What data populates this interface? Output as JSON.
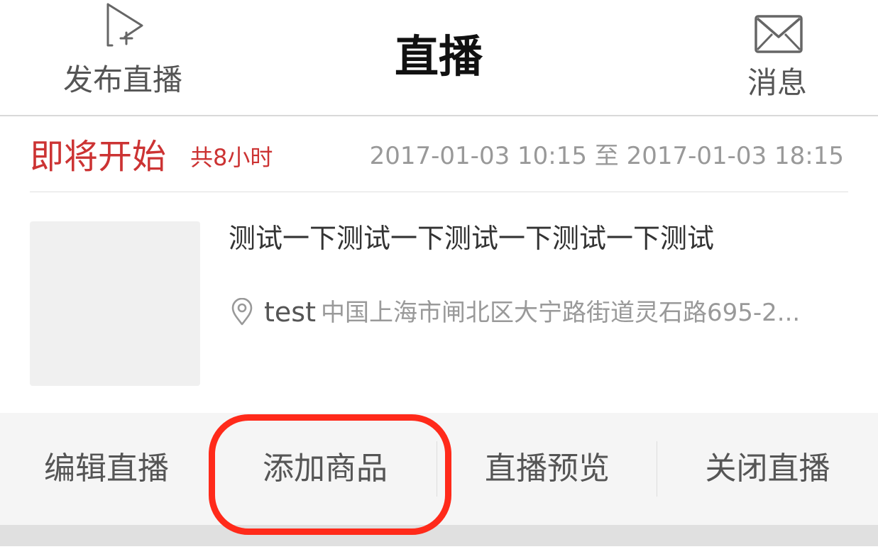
{
  "header": {
    "publish_label": "发布直播",
    "publish_icon": "video-plus-icon",
    "title": "直播",
    "message_label": "消息",
    "message_icon": "envelope-icon"
  },
  "card": {
    "status": "即将开始",
    "duration": "共8小时",
    "time_range": "2017-01-03 10:15 至 2017-01-03 18:15",
    "title": "测试一下测试一下测试一下测试一下测试",
    "location_icon": "location-pin-icon",
    "location_name": "test",
    "location_address": "中国上海市闸北区大宁路街道灵石路695-2..."
  },
  "actions": {
    "edit_label": "编辑直播",
    "add_goods_label": "添加商品",
    "preview_label": "直播预览",
    "close_label": "关闭直播"
  },
  "colors": {
    "status_red": "#cc3333",
    "highlight_red": "#ff2a1a",
    "muted_text": "#999999",
    "action_bar_bg": "#f5f5f5"
  }
}
